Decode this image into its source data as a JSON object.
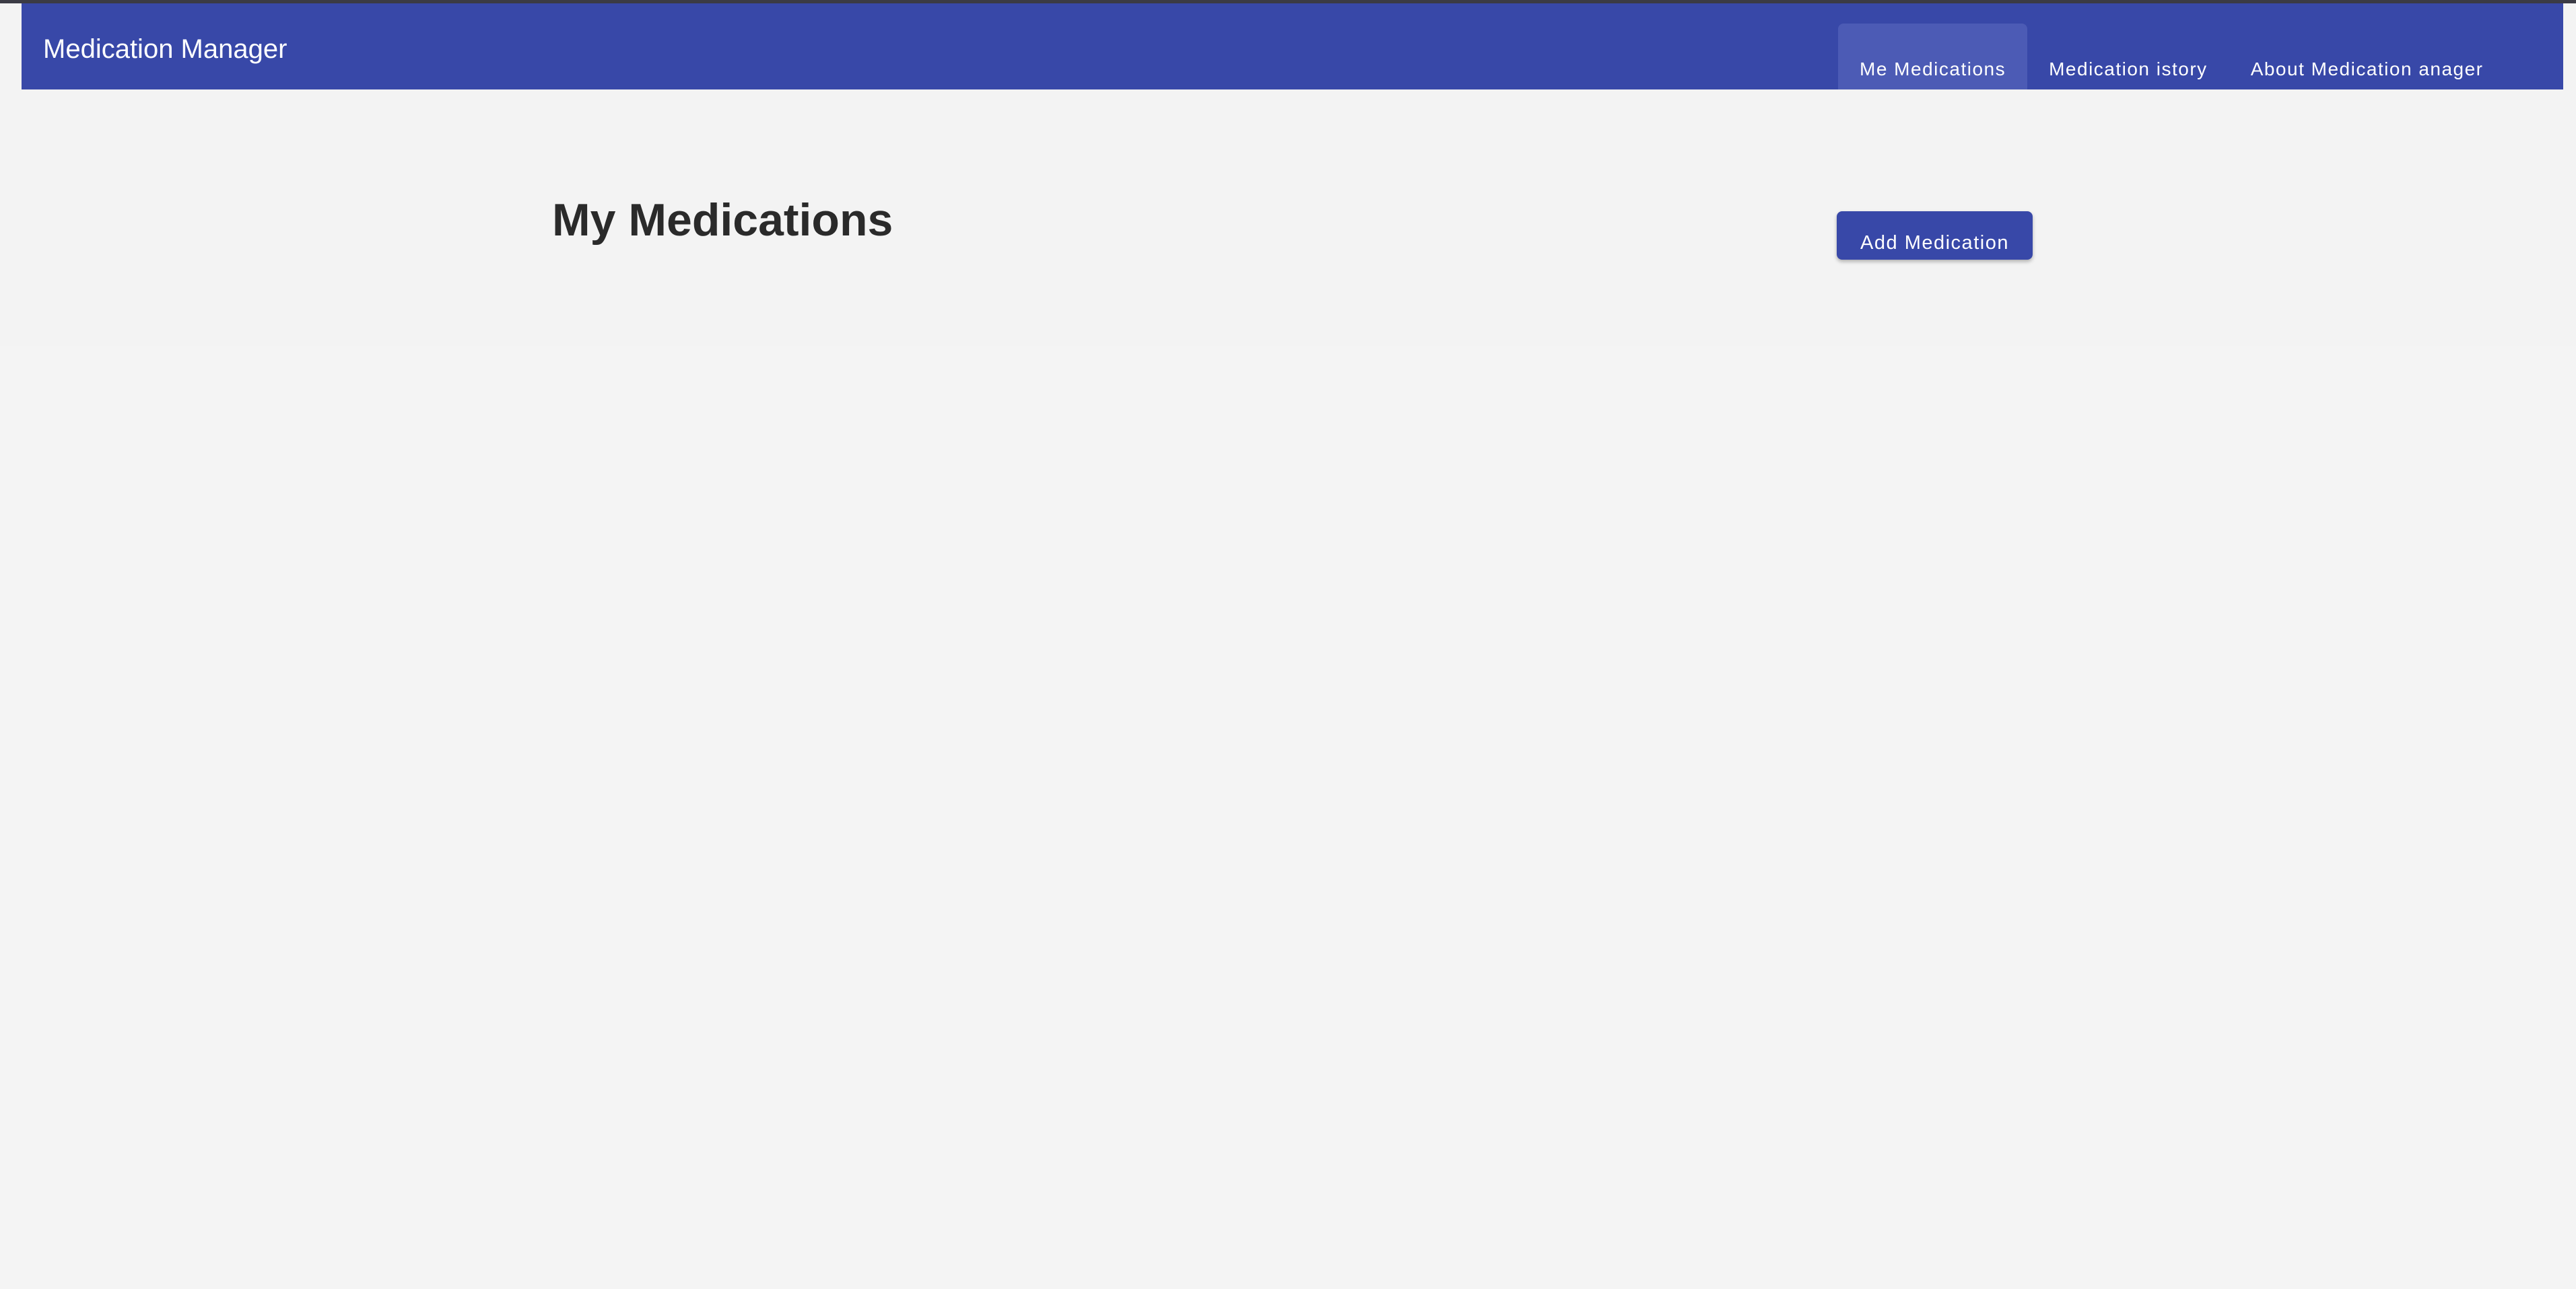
{
  "app": {
    "title": "Medication Manager"
  },
  "nav": {
    "items": [
      {
        "label": "Me Medications",
        "active": true
      },
      {
        "label": "Medication istory",
        "active": false
      },
      {
        "label": "About Medication anager",
        "active": false
      }
    ]
  },
  "main": {
    "title": "My Medications",
    "add_button_label": "Add Medication"
  },
  "colors": {
    "primary": "#3848a8",
    "active_tab": "#4c5bb5",
    "background": "#f3f3f3",
    "title_text": "#2a2a2a"
  }
}
